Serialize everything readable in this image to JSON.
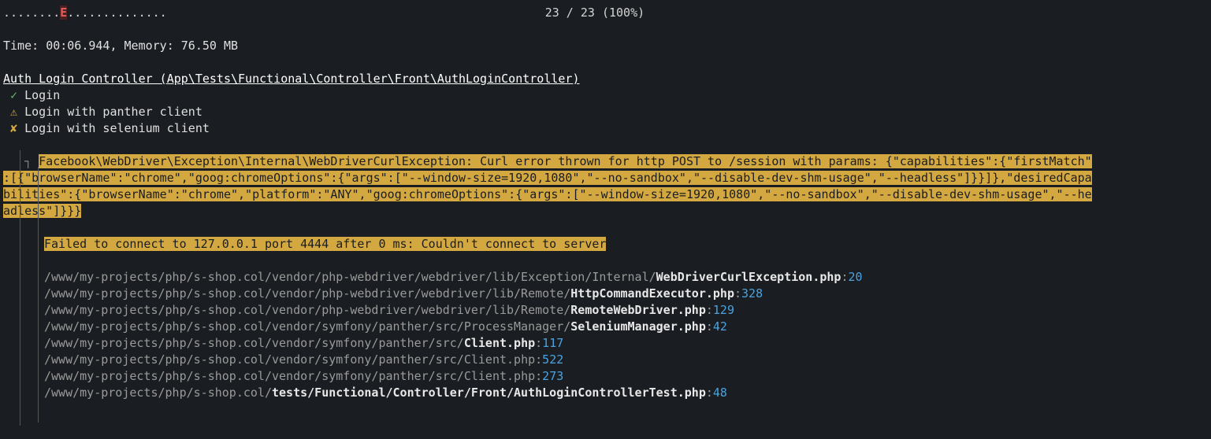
{
  "progress": {
    "dots_before": "........",
    "error_char": "E",
    "dots_after": "..............",
    "current": "23",
    "total": "23",
    "percent": "100%"
  },
  "timing": {
    "label": "Time:",
    "time": "00:06.944",
    "mem_label": "Memory:",
    "mem": "76.50 MB"
  },
  "suite": {
    "title": "Auth Login Controller (App\\Tests\\Functional\\Controller\\Front\\AuthLoginController)"
  },
  "tests": [
    {
      "icon": "✓",
      "name": "Login",
      "status": "pass"
    },
    {
      "icon": "⚠",
      "name": "Login with panther client",
      "status": "warn"
    },
    {
      "icon": "✘",
      "name": "Login with selenium client",
      "status": "fail"
    }
  ],
  "exception": {
    "prefix": "   ",
    "line1": "Facebook\\WebDriver\\Exception\\Internal\\WebDriverCurlException: Curl error thrown for http POST to /session with params: {\"capabilities\":{\"firstMatch\"",
    "line2": ":[{\"browserName\":\"chrome\",\"goog:chromeOptions\":{\"args\":[\"--window-size=1920,1080\",\"--no-sandbox\",\"--disable-dev-shm-usage\",\"--headless\"]}}]},\"desiredCapa",
    "line3": "bilities\":{\"browserName\":\"chrome\",\"platform\":\"ANY\",\"goog:chromeOptions\":{\"args\":[\"--window-size=1920,1080\",\"--no-sandbox\",\"--disable-dev-shm-usage\",\"--he",
    "line4": "adless\"]}}}",
    "msg2": "Failed to connect to 127.0.0.1 port 4444 after 0 ms: Couldn't connect to server"
  },
  "trace": [
    {
      "path": "/www/my-projects/php/s-shop.col/vendor/php-webdriver/webdriver/lib/Exception/Internal/",
      "file": "WebDriverCurlException.php",
      "line": "20"
    },
    {
      "path": "/www/my-projects/php/s-shop.col/vendor/php-webdriver/webdriver/lib/Remote/",
      "file": "HttpCommandExecutor.php",
      "line": "328"
    },
    {
      "path": "/www/my-projects/php/s-shop.col/vendor/php-webdriver/webdriver/lib/Remote/",
      "file": "RemoteWebDriver.php",
      "line": "129"
    },
    {
      "path": "/www/my-projects/php/s-shop.col/vendor/symfony/panther/src/ProcessManager/",
      "file": "SeleniumManager.php",
      "line": "42"
    },
    {
      "path": "/www/my-projects/php/s-shop.col/vendor/symfony/panther/src/",
      "file": "Client.php",
      "line": "117"
    },
    {
      "path": "/www/my-projects/php/s-shop.col/vendor/",
      "file": "symfony/panther/src/Client.php",
      "line": "522",
      "allgrey": true
    },
    {
      "path": "/www/my-projects/php/s-shop.col/vendor/",
      "file": "symfony/panther/src/Client.php",
      "line": "273",
      "allgrey": true
    },
    {
      "path": "/www/my-projects/php/s-shop.col/tests/Functional/Controller/Front/",
      "file": "AuthLoginControllerTest.php",
      "line": "48",
      "white_path": true
    }
  ]
}
